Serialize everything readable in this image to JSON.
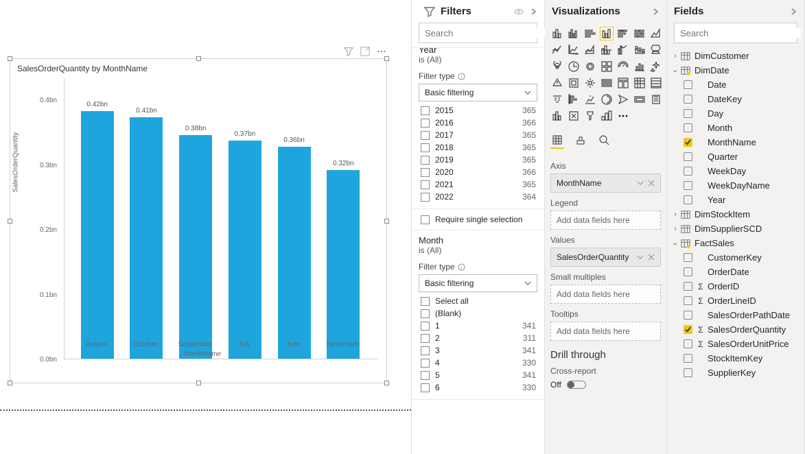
{
  "chart_data": {
    "type": "bar",
    "title": "SalesOrderQuantity by MonthName",
    "xlabel": "MonthName",
    "ylabel": "SalesOrderQuantity",
    "ylim": [
      0,
      0.42
    ],
    "yticks": [
      "0.0bn",
      "0.1bn",
      "0.2bn",
      "0.3bn",
      "0.4bn"
    ],
    "categories": [
      "August",
      "October",
      "September",
      "July",
      "June",
      "November"
    ],
    "values": [
      0.42,
      0.41,
      0.38,
      0.37,
      0.36,
      0.32
    ],
    "data_labels": [
      "0.42bn",
      "0.41bn",
      "0.38bn",
      "0.37bn",
      "0.36bn",
      "0.32bn"
    ]
  },
  "filters": {
    "title": "Filters",
    "search_placeholder": "Search",
    "year": {
      "name": "Year",
      "sub": "is (All)",
      "type_label": "Filter type",
      "type_value": "Basic filtering",
      "items": [
        {
          "l": "2015",
          "c": "365"
        },
        {
          "l": "2016",
          "c": "366"
        },
        {
          "l": "2017",
          "c": "365"
        },
        {
          "l": "2018",
          "c": "365"
        },
        {
          "l": "2019",
          "c": "365"
        },
        {
          "l": "2020",
          "c": "366"
        },
        {
          "l": "2021",
          "c": "365"
        },
        {
          "l": "2022",
          "c": "364"
        }
      ],
      "single": "Require single selection"
    },
    "month": {
      "name": "Month",
      "sub": "is (All)",
      "type_label": "Filter type",
      "type_value": "Basic filtering",
      "items": [
        {
          "l": "Select all",
          "c": ""
        },
        {
          "l": "(Blank)",
          "c": ""
        },
        {
          "l": "1",
          "c": "341"
        },
        {
          "l": "2",
          "c": "311"
        },
        {
          "l": "3",
          "c": "341"
        },
        {
          "l": "4",
          "c": "330"
        },
        {
          "l": "5",
          "c": "341"
        },
        {
          "l": "6",
          "c": "330"
        }
      ]
    }
  },
  "viz": {
    "title": "Visualizations",
    "axis": "Axis",
    "axis_field": "MonthName",
    "legend": "Legend",
    "values": "Values",
    "values_field": "SalesOrderQuantity",
    "small": "Small multiples",
    "tooltips": "Tooltips",
    "add": "Add data fields here",
    "drill": "Drill through",
    "cross": "Cross-report",
    "off": "Off"
  },
  "fields": {
    "title": "Fields",
    "search_placeholder": "Search",
    "tables": [
      {
        "name": "DimCustomer",
        "open": false
      },
      {
        "name": "DimDate",
        "open": true,
        "marked": true,
        "cols": [
          {
            "n": "Date"
          },
          {
            "n": "DateKey"
          },
          {
            "n": "Day"
          },
          {
            "n": "Month"
          },
          {
            "n": "MonthName",
            "chk": true
          },
          {
            "n": "Quarter"
          },
          {
            "n": "WeekDay"
          },
          {
            "n": "WeekDayName"
          },
          {
            "n": "Year"
          }
        ]
      },
      {
        "name": "DimStockItem",
        "open": false
      },
      {
        "name": "DimSupplierSCD",
        "open": false
      },
      {
        "name": "FactSales",
        "open": true,
        "marked": true,
        "cols": [
          {
            "n": "CustomerKey"
          },
          {
            "n": "OrderDate"
          },
          {
            "n": "OrderID",
            "sig": "Σ"
          },
          {
            "n": "OrderLineID",
            "sig": "Σ"
          },
          {
            "n": "SalesOrderPathDate"
          },
          {
            "n": "SalesOrderQuantity",
            "sig": "Σ",
            "chk": true
          },
          {
            "n": "SalesOrderUnitPrice",
            "sig": "Σ"
          },
          {
            "n": "StockItemKey"
          },
          {
            "n": "SupplierKey"
          }
        ]
      }
    ]
  }
}
